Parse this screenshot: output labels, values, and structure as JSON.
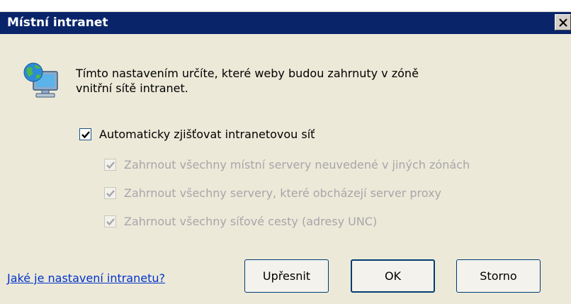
{
  "window": {
    "title": "Místní intranet",
    "close_glyph": "×"
  },
  "icon": {
    "name": "intranet-zone-icon"
  },
  "description": {
    "line1": "Tímto nastavením určíte, které weby budou zahrnuty v zóně",
    "line2": "vnitřní sítě intranet."
  },
  "options": {
    "auto_detect": {
      "label": "Automaticky zjišťovat intranetovou síť",
      "checked": true,
      "enabled": true
    },
    "local_servers": {
      "label": "Zahrnout všechny místní servery neuvedené v jiných zónách",
      "checked": true,
      "enabled": false
    },
    "bypass_proxy": {
      "label": "Zahrnout všechny servery, které obcházejí server proxy",
      "checked": true,
      "enabled": false
    },
    "unc_paths": {
      "label": "Zahrnout všechny síťové cesty (adresy UNC)",
      "checked": true,
      "enabled": false
    }
  },
  "footer": {
    "help_link": "Jaké je nastavení intranetu?",
    "advanced_label": "Upřesnit",
    "ok_label": "OK",
    "cancel_label": "Storno"
  },
  "colors": {
    "titlebar": "#0a246a",
    "dialog_bg": "#ece9d8",
    "link": "#0033cc",
    "disabled_text": "#a7a6aa"
  }
}
